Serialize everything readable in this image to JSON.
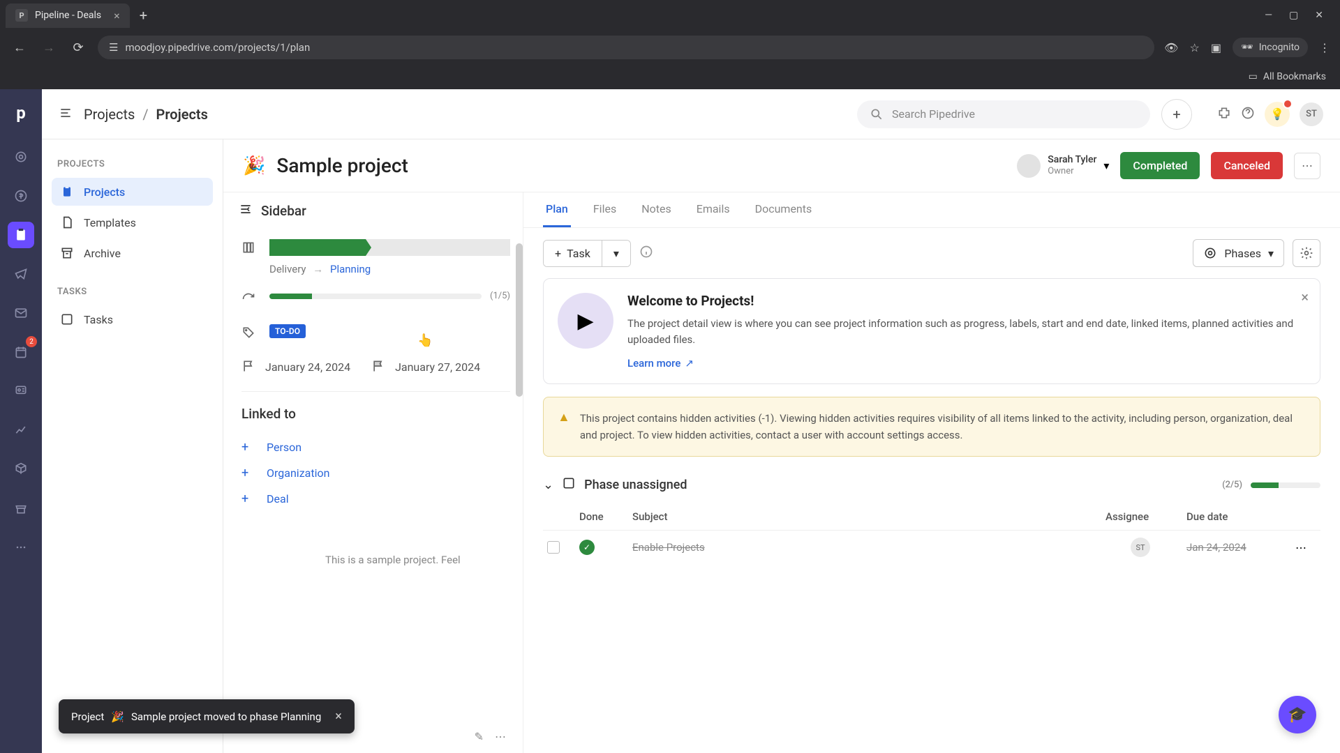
{
  "browser": {
    "tab_title": "Pipeline - Deals",
    "url": "moodjoy.pipedrive.com/projects/1/plan",
    "incognito": "Incognito",
    "all_bookmarks": "All Bookmarks"
  },
  "topbar": {
    "breadcrumb_root": "Projects",
    "breadcrumb_current": "Projects",
    "search_placeholder": "Search Pipedrive",
    "user_initials": "ST"
  },
  "rail": {
    "badge_count": "2"
  },
  "leftnav": {
    "section_projects": "PROJECTS",
    "item_projects": "Projects",
    "item_templates": "Templates",
    "item_archive": "Archive",
    "section_tasks": "TASKS",
    "item_tasks": "Tasks"
  },
  "project": {
    "emoji": "🎉",
    "title": "Sample project",
    "owner_name": "Sarah Tyler",
    "owner_role": "Owner",
    "btn_completed": "Completed",
    "btn_canceled": "Canceled"
  },
  "sidebar": {
    "title": "Sidebar",
    "phase_from": "Delivery",
    "phase_to": "Planning",
    "progress_text": "(1/5)",
    "label_badge": "TO-DO",
    "start_date": "January 24, 2024",
    "end_date": "January 27, 2024",
    "linked_title": "Linked to",
    "linked_person": "Person",
    "linked_org": "Organization",
    "linked_deal": "Deal",
    "desc_preview": "This is a sample project. Feel"
  },
  "tabs": {
    "plan": "Plan",
    "files": "Files",
    "notes": "Notes",
    "emails": "Emails",
    "documents": "Documents"
  },
  "toolbar": {
    "task": "Task",
    "phases": "Phases"
  },
  "welcome": {
    "title": "Welcome to Projects!",
    "body": "The project detail view is where you can see project information such as progress, labels, start and end date, linked items, planned activities and uploaded files.",
    "learn_more": "Learn more"
  },
  "warning": {
    "text": "This project contains hidden activities (-1). Viewing hidden activities requires visibility of all items linked to the activity, including person, organization, deal and project. To view hidden activities, contact a user with account settings access."
  },
  "phase_block": {
    "title": "Phase unassigned",
    "count": "(2/5)",
    "col_done": "Done",
    "col_subject": "Subject",
    "col_assignee": "Assignee",
    "col_due": "Due date",
    "row1_subject": "Enable Projects",
    "row1_assignee": "ST",
    "row1_due": "Jan 24, 2024"
  },
  "toast": {
    "prefix": "Project",
    "emoji": "🎉",
    "rest": "Sample project moved to phase Planning"
  }
}
